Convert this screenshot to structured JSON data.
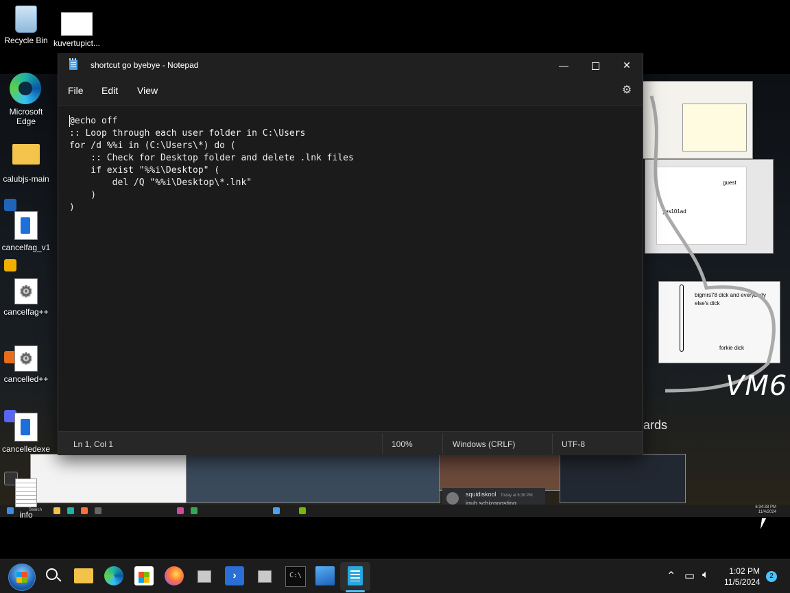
{
  "desktop": {
    "icons": [
      {
        "label": "Recycle Bin",
        "icon": "recycle-bin-icon"
      },
      {
        "label": "kuvertupict...",
        "icon": "image-file-icon"
      },
      {
        "label": "Microsoft Edge",
        "icon": "edge-icon"
      },
      {
        "label": "calubjs-main",
        "icon": "folder-icon"
      },
      {
        "label": "cancelfag_v1",
        "icon": "document-icon"
      },
      {
        "label": "cancelfag++",
        "icon": "gear-icon"
      },
      {
        "label": "cancelled++",
        "icon": "gear-icon"
      },
      {
        "label": "cancelledexe",
        "icon": "document-icon"
      },
      {
        "label": "info",
        "icon": "text-file-icon"
      }
    ],
    "background_texts": {
      "vm6": "VM6",
      "drawing1": "bigmrs78 dick and everybody else's dick",
      "drawing2": "forkie dick",
      "cards": "ards",
      "sketch_names": [
        "guest",
        "yes101ad"
      ]
    },
    "inner_taskbar": {
      "search_label": "Search",
      "time": "6:34:38 PM",
      "date": "11/4/2024"
    },
    "discord_message": {
      "username": "squidiskool",
      "time": "Today at 6:38 PM",
      "text": "inub schizoposting"
    }
  },
  "notepad": {
    "title": "shortcut go byebye - Notepad",
    "menu": [
      "File",
      "Edit",
      "View"
    ],
    "content": "@echo off\n:: Loop through each user folder in C:\\Users\nfor /d %%i in (C:\\Users\\*) do (\n    :: Check for Desktop folder and delete .lnk files\n    if exist \"%%i\\Desktop\" (\n        del /Q \"%%i\\Desktop\\*.lnk\"\n    )\n)",
    "status": {
      "position": "Ln 1, Col 1",
      "zoom": "100%",
      "line_ending": "Windows (CRLF)",
      "encoding": "UTF-8"
    },
    "window_buttons": {
      "minimize": "—",
      "close": "✕"
    }
  },
  "taskbar": {
    "time": "1:02 PM",
    "date": "11/5/2024",
    "notification_count": "2",
    "pinned": [
      "start-icon",
      "search-icon",
      "file-explorer-icon",
      "edge-icon",
      "microsoft-store-icon",
      "firefox-icon",
      "vm-icon",
      "powershell-icon",
      "vm-icon",
      "terminal-icon",
      "photos-icon",
      "notepad-icon"
    ],
    "accent": "#4cc2ff"
  }
}
